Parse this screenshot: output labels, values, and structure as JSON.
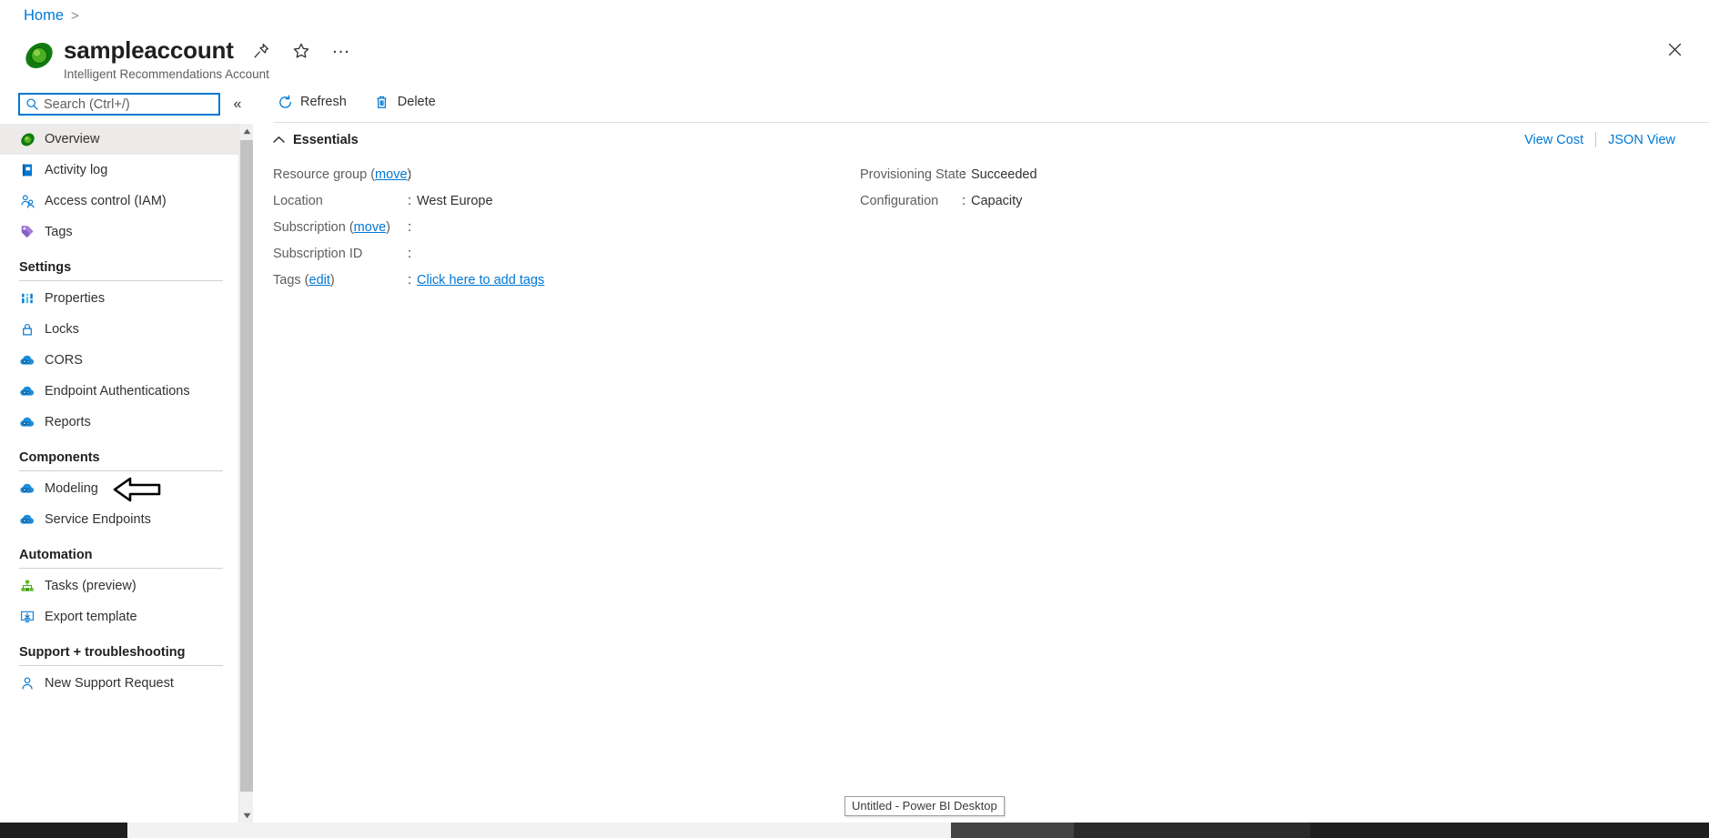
{
  "breadcrumb": {
    "home_label": "Home",
    "separator": ">"
  },
  "resource": {
    "title": "sampleaccount",
    "subtitle": "Intelligent Recommendations Account",
    "icon": "intelligent-recommendations-icon"
  },
  "header_actions": {
    "pin_label": "Pin",
    "favorite_label": "Favorite",
    "more_label": "...",
    "close_label": "Close"
  },
  "search": {
    "placeholder": "Search (Ctrl+/)",
    "value": "",
    "icon": "search-icon",
    "collapse_label": "«"
  },
  "sidebar": {
    "top_items": [
      {
        "label": "Overview",
        "icon": "overview-icon",
        "selected": true
      },
      {
        "label": "Activity log",
        "icon": "activity-log-icon",
        "selected": false
      },
      {
        "label": "Access control (IAM)",
        "icon": "access-control-icon",
        "selected": false
      },
      {
        "label": "Tags",
        "icon": "tags-icon",
        "selected": false
      }
    ],
    "groups": [
      {
        "title": "Settings",
        "items": [
          {
            "label": "Properties",
            "icon": "properties-icon"
          },
          {
            "label": "Locks",
            "icon": "lock-icon"
          },
          {
            "label": "CORS",
            "icon": "cloud-gear-icon"
          },
          {
            "label": "Endpoint Authentications",
            "icon": "cloud-gear-icon"
          },
          {
            "label": "Reports",
            "icon": "cloud-gear-icon"
          }
        ]
      },
      {
        "title": "Components",
        "items": [
          {
            "label": "Modeling",
            "icon": "cloud-gear-icon"
          },
          {
            "label": "Service Endpoints",
            "icon": "cloud-gear-icon"
          }
        ]
      },
      {
        "title": "Automation",
        "items": [
          {
            "label": "Tasks (preview)",
            "icon": "tasks-icon"
          },
          {
            "label": "Export template",
            "icon": "export-template-icon"
          }
        ]
      },
      {
        "title": "Support + troubleshooting",
        "items": [
          {
            "label": "New Support Request",
            "icon": "support-person-icon"
          }
        ]
      }
    ]
  },
  "toolbar": {
    "refresh_label": "Refresh",
    "refresh_icon": "refresh-icon",
    "delete_label": "Delete",
    "delete_icon": "trash-icon"
  },
  "essentials": {
    "title": "Essentials",
    "collapse_icon": "chevron-up-icon",
    "view_cost_label": "View Cost",
    "json_view_label": "JSON View",
    "left_rows": [
      {
        "key": "Resource group",
        "key_link": "move",
        "colon": ":",
        "value": "",
        "value_is_link": false
      },
      {
        "key": "Location",
        "key_link": "",
        "colon": ":",
        "value": "West Europe",
        "value_is_link": false
      },
      {
        "key": "Subscription",
        "key_link": "move",
        "colon": ":",
        "value": "",
        "value_is_link": false
      },
      {
        "key": "Subscription ID",
        "key_link": "",
        "colon": ":",
        "value": "",
        "value_is_link": false
      },
      {
        "key": "Tags",
        "key_link": "edit",
        "colon": ":",
        "value": "Click here to add tags",
        "value_is_link": true
      }
    ],
    "right_rows": [
      {
        "key": "Provisioning State",
        "colon": ":",
        "value": "Succeeded"
      },
      {
        "key": "Configuration",
        "colon": ":",
        "value": "Capacity"
      }
    ]
  },
  "annotation": {
    "arrow_target": "Modeling",
    "arrow_direction": "left"
  },
  "taskbar": {
    "tooltip_text": "Untitled - Power BI Desktop"
  },
  "colors": {
    "accent_blue": "#0078d4",
    "link_blue": "#0078d4",
    "selected_bg": "#edebe9",
    "text_primary": "#201f1e",
    "text_secondary": "#605e5c",
    "divider": "#d2d0ce"
  }
}
